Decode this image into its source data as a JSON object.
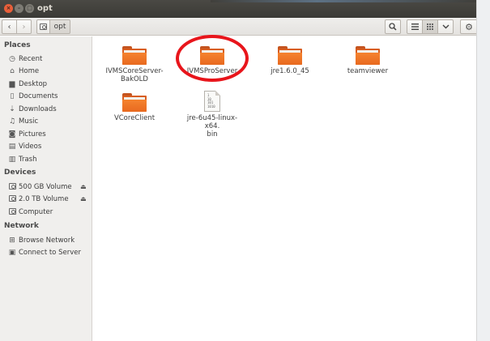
{
  "window": {
    "title": "opt"
  },
  "toolbar": {
    "back_icon": "‹",
    "forward_icon": "›",
    "breadcrumb": [
      "opt"
    ]
  },
  "sidebar": {
    "places_header": "Places",
    "places": [
      {
        "label": "Recent",
        "icon": "clock-icon"
      },
      {
        "label": "Home",
        "icon": "home-icon"
      },
      {
        "label": "Desktop",
        "icon": "desktop-icon"
      },
      {
        "label": "Documents",
        "icon": "document-icon"
      },
      {
        "label": "Downloads",
        "icon": "download-icon"
      },
      {
        "label": "Music",
        "icon": "music-icon"
      },
      {
        "label": "Pictures",
        "icon": "camera-icon"
      },
      {
        "label": "Videos",
        "icon": "film-icon"
      },
      {
        "label": "Trash",
        "icon": "trash-icon"
      }
    ],
    "devices_header": "Devices",
    "devices": [
      {
        "label": "500 GB Volume",
        "icon": "drive-icon"
      },
      {
        "label": "2.0 TB Volume",
        "icon": "drive-icon"
      },
      {
        "label": "Computer",
        "icon": "drive-icon"
      }
    ],
    "network_header": "Network",
    "network": [
      {
        "label": "Browse Network",
        "icon": "network-icon"
      },
      {
        "label": "Connect to Server",
        "icon": "server-icon"
      }
    ]
  },
  "files": [
    {
      "name": "IVMSCoreServer-\nBakOLD",
      "type": "folder"
    },
    {
      "name": "IVMSProServer",
      "type": "folder"
    },
    {
      "name": "jre1.6.0_45",
      "type": "folder"
    },
    {
      "name": "teamviewer",
      "type": "folder"
    },
    {
      "name": "VCoreClient",
      "type": "folder"
    },
    {
      "name": "jre-6u45-linux-x64.\nbin",
      "type": "binary"
    }
  ],
  "binary_preview": "1\n10\n101\n1010",
  "colors": {
    "folder_orange": "#f07a2a",
    "highlight_red": "#e8151b",
    "titlebar": "#3b3a36"
  }
}
